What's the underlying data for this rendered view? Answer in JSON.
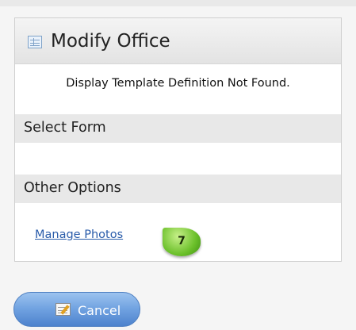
{
  "panel": {
    "title": "Modify Office",
    "title_icon": "form-icon",
    "message": "Display Template Definition Not Found.",
    "select_form_heading": "Select Form",
    "other_options_heading": "Other Options",
    "manage_photos_link": "Manage Photos",
    "step_badge": "7"
  },
  "footer": {
    "cancel_label": "Cancel",
    "cancel_icon": "edit-cancel-icon"
  },
  "colors": {
    "link": "#2a5caa",
    "badge": "#6bc02a",
    "button": "#6fa1e0"
  }
}
